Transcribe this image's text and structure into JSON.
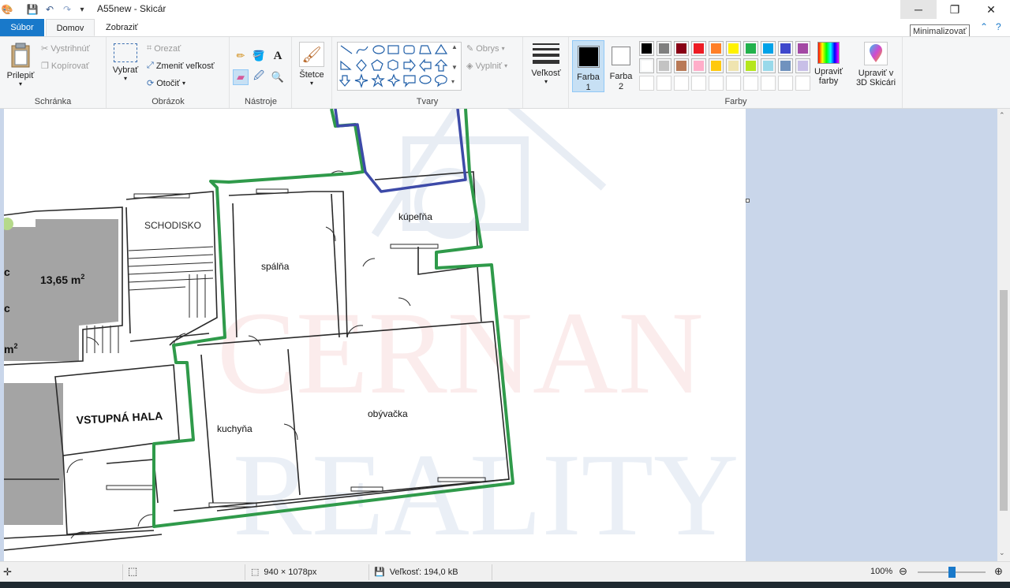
{
  "window": {
    "title": "A55new - Skicár",
    "tooltip": "Minimalizovať"
  },
  "tabs": {
    "file": "Súbor",
    "home": "Domov",
    "view": "Zobraziť"
  },
  "ribbon": {
    "clipboard": {
      "group_label": "Schránka",
      "paste": "Prilepiť",
      "cut": "Vystrihnúť",
      "copy": "Kopírovať"
    },
    "image": {
      "group_label": "Obrázok",
      "select": "Vybrať",
      "crop": "Orezať",
      "resize": "Zmeniť veľkosť",
      "rotate": "Otočiť"
    },
    "tools": {
      "group_label": "Nástroje"
    },
    "brushes": {
      "label": "Štetce"
    },
    "shapes": {
      "group_label": "Tvary",
      "outline": "Obrys",
      "fill": "Vyplniť"
    },
    "size": {
      "label": "Veľkosť"
    },
    "colors": {
      "group_label": "Farby",
      "color1": "Farba",
      "color1_num": "1",
      "color2": "Farba",
      "color2_num": "2",
      "edit_colors_1": "Upraviť",
      "edit_colors_2": "farby",
      "paint3d_1": "Upraviť v",
      "paint3d_2": "3D Skicári",
      "color1_value": "#000000",
      "color2_value": "#ffffff",
      "palette_row1": [
        "#000000",
        "#7f7f7f",
        "#880015",
        "#ed1c24",
        "#ff7f27",
        "#fff200",
        "#22b14c",
        "#00a2e8",
        "#3f48cc",
        "#a349a4"
      ],
      "palette_row2": [
        "#ffffff",
        "#c3c3c3",
        "#b97a57",
        "#ffaec9",
        "#ffc90e",
        "#efe4b0",
        "#b5e61d",
        "#99d9ea",
        "#7092be",
        "#c8bfe7"
      ]
    }
  },
  "floorplan": {
    "rooms": {
      "schodisko": "SCHODISKO",
      "kupelna": "kúpeľňa",
      "spalna": "spálňa",
      "area": "13,65 m",
      "area_sup": "2",
      "vstupna_hala": "VSTUPNÁ HALA",
      "kuchyna": "kuchyňa",
      "obyvacka": "obývačka",
      "edge_c1": "c",
      "edge_c2": "c",
      "edge_m": "m",
      "edge_m_sup": "2"
    },
    "watermark": {
      "line1": "CERNAN",
      "line2": "REALITY"
    }
  },
  "status": {
    "dimensions": "940 × 1078px",
    "size": "Veľkosť: 194,0 kB",
    "zoom": "100%",
    "zoom_level_percent": 100
  }
}
